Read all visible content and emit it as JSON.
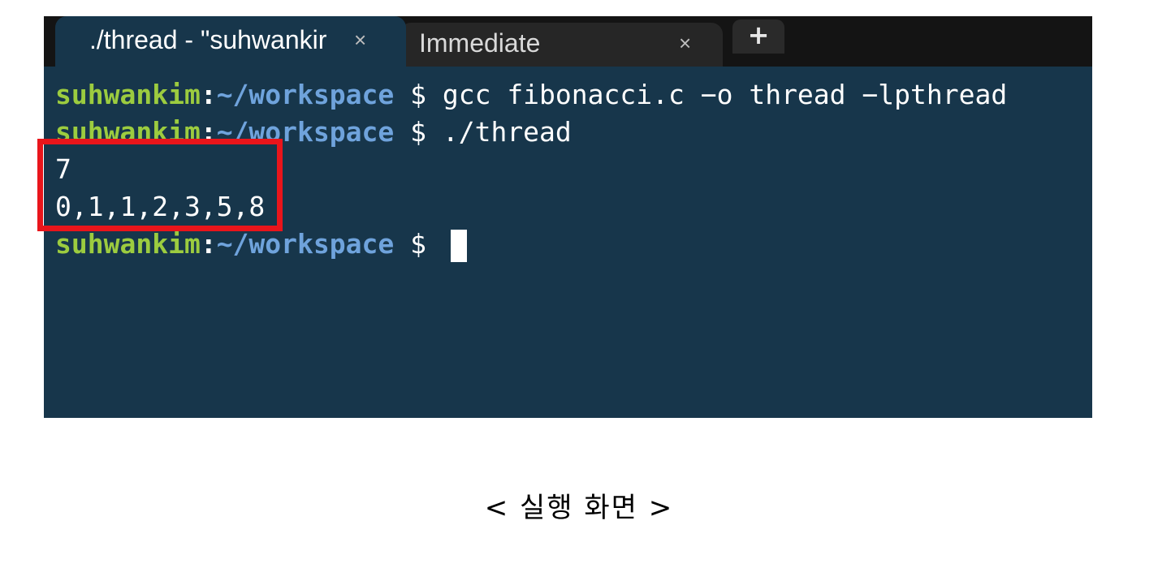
{
  "tabs": [
    {
      "label": "./thread - \"suhwankir",
      "close": "×",
      "active": true
    },
    {
      "label": "Immediate",
      "close": "×",
      "active": false
    }
  ],
  "new_tab_label": "+",
  "terminal": {
    "lines": [
      {
        "user": "suhwankim",
        "colon": ":",
        "path": "~/workspace",
        "prompt": " $ ",
        "command": "gcc fibonacci.c −o thread −lpthread"
      },
      {
        "user": "suhwankim",
        "colon": ":",
        "path": "~/workspace",
        "prompt": " $ ",
        "command": "./thread"
      },
      {
        "output": "7"
      },
      {
        "output": "0,1,1,2,3,5,8"
      },
      {
        "user": "suhwankim",
        "colon": ":",
        "path": "~/workspace",
        "prompt": " $ ",
        "command": ""
      }
    ]
  },
  "caption": "< 실행 화면 >",
  "colors": {
    "terminal_bg": "#17364b",
    "user": "#9ccc3f",
    "path": "#6fa3dc",
    "highlight": "#e9151b"
  }
}
